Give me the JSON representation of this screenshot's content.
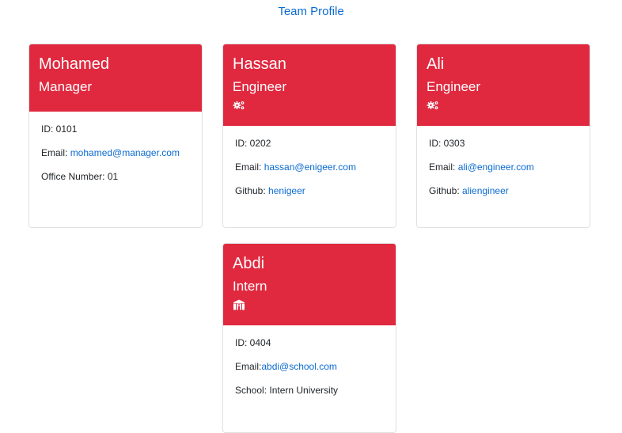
{
  "page": {
    "title": "Team Profile"
  },
  "colors": {
    "header_red": "#e0293f",
    "link_blue": "#0b6bd0"
  },
  "cards": [
    {
      "name": "Mohamed",
      "role": "Manager",
      "icon": "",
      "rows": [
        {
          "label": "ID: ",
          "value": "0101",
          "is_link": false
        },
        {
          "label": "Email: ",
          "value": "mohamed@manager.com",
          "is_link": true
        },
        {
          "label": "Office Number: ",
          "value": "01",
          "is_link": false
        }
      ]
    },
    {
      "name": "Hassan",
      "role": "Engineer",
      "icon": "gears-icon",
      "rows": [
        {
          "label": "ID: ",
          "value": "0202",
          "is_link": false
        },
        {
          "label": "Email: ",
          "value": "hassan@enigeer.com",
          "is_link": true
        },
        {
          "label": "Github: ",
          "value": "henigeer",
          "is_link": true
        }
      ]
    },
    {
      "name": "Ali",
      "role": "Engineer",
      "icon": "gears-icon",
      "rows": [
        {
          "label": "ID: ",
          "value": "0303",
          "is_link": false
        },
        {
          "label": "Email: ",
          "value": "ali@engineer.com",
          "is_link": true
        },
        {
          "label": "Github: ",
          "value": "aliengineer",
          "is_link": true
        }
      ]
    },
    {
      "name": "Abdi",
      "role": "Intern",
      "icon": "school-icon",
      "rows": [
        {
          "label": "ID: ",
          "value": "0404",
          "is_link": false
        },
        {
          "label": "Email:",
          "value": "abdi@school.com",
          "is_link": true
        },
        {
          "label": "School: ",
          "value": "Intern University",
          "is_link": false
        }
      ]
    }
  ]
}
